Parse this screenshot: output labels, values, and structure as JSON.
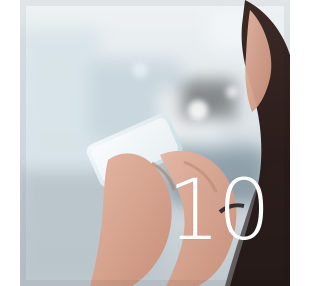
{
  "image": {
    "subject": "",
    "overlay_number": "10",
    "colors": {
      "sky_light": "#e9eef1",
      "sky_mid": "#cfd8dc",
      "shadow_blue": "#3b4f5f",
      "skin": "#d8a58f",
      "hair": "#2a1b19",
      "screen_glow": "#ffffff"
    }
  }
}
